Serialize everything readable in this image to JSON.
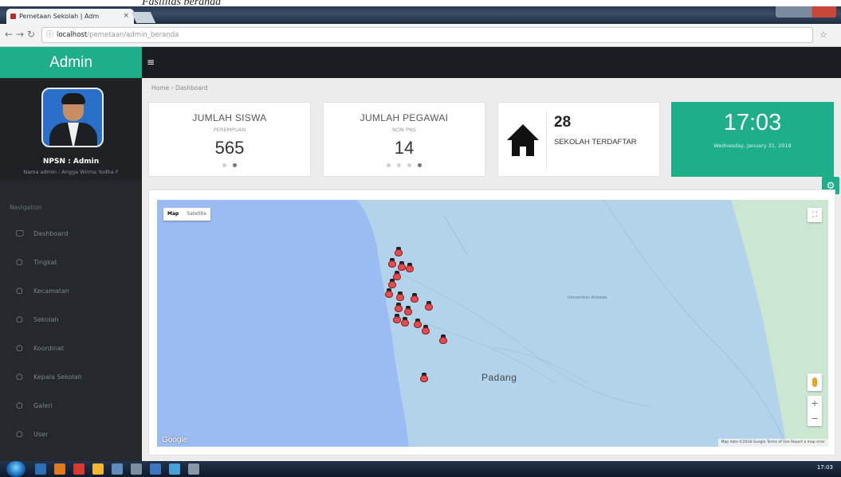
{
  "caption": {
    "text": "Fasilitas beranda"
  },
  "browser": {
    "tab_title": "Pemetaan Sekolah | Adm",
    "tab_close": "×",
    "url_host": "localhost",
    "url_path": "/pemetaan/admin_beranda",
    "info_glyph": "ⓘ",
    "star_glyph": "☆"
  },
  "app": {
    "brand": "Admin",
    "menu_toggle_glyph": "≡"
  },
  "profile": {
    "npsn": "NPSN : Admin",
    "subtitle": "Nama admin : Angga Wirma Yudha F"
  },
  "sidebar": {
    "header": "Navigation",
    "items": [
      {
        "label": "Dashboard",
        "icon": "monitor-icon",
        "glyph": "🖵"
      },
      {
        "label": "Tingkat",
        "icon": "circle-icon",
        "glyph": "○"
      },
      {
        "label": "Kecamatan",
        "icon": "circle-icon",
        "glyph": "○"
      },
      {
        "label": "Sekolah",
        "icon": "circle-icon",
        "glyph": "○"
      },
      {
        "label": "Koordinat",
        "icon": "circle-icon",
        "glyph": "○"
      },
      {
        "label": "Kepala Sekolah",
        "icon": "circle-icon",
        "glyph": "○"
      },
      {
        "label": "Galeri",
        "icon": "circle-icon",
        "glyph": "○"
      },
      {
        "label": "User",
        "icon": "circle-icon",
        "glyph": "○"
      }
    ]
  },
  "breadcrumb": {
    "home": "Home",
    "sep": "›",
    "current": "Dashboard"
  },
  "stats": {
    "siswa": {
      "title": "JUMLAH SISWA",
      "subtitle": "PEREMPUAN",
      "value": "565",
      "dots": 2,
      "active": 1
    },
    "pegawai": {
      "title": "JUMLAH PEGAWAI",
      "subtitle": "NON PNS",
      "value": "14",
      "dots": 4,
      "active": 3
    },
    "sekolah": {
      "value": "28",
      "label": "SEKOLAH TERDAFTAR",
      "icon": "home-icon",
      "glyph": "🏠"
    }
  },
  "clock": {
    "time": "17:03",
    "date": "Wednesday, January 31, 2018"
  },
  "map": {
    "type_map": "Map",
    "type_satellite": "Satellite",
    "city_label": "Padang",
    "university_label": "Universitas Andalas",
    "google_logo": "Google",
    "attribution": "Map data ©2018 Google   Terms of Use   Report a map error",
    "zoom_in": "+",
    "zoom_out": "−",
    "fullscreen_glyph": "⛶",
    "colors": {
      "sea": "#9bbcf2",
      "land": "#b3d3ea",
      "hills": "#cbe6d1",
      "accent": "#1fae8a"
    }
  },
  "taskbar": {
    "clock": "17:03"
  }
}
